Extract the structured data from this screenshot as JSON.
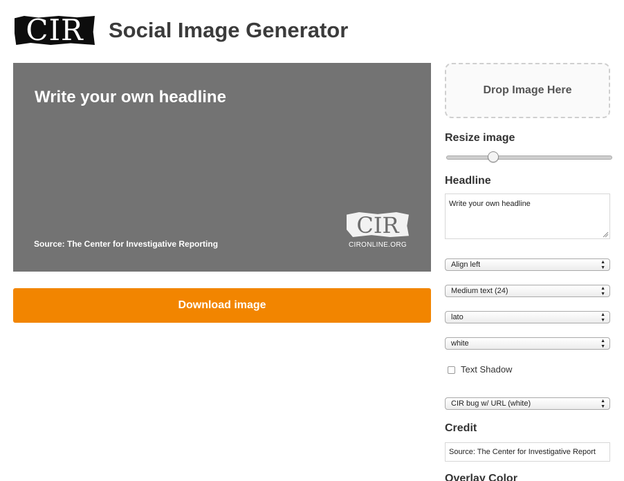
{
  "header": {
    "logo_text": "CIR",
    "title": "Social Image Generator"
  },
  "preview": {
    "headline": "Write your own headline",
    "credit": "Source: The Center for Investigative Reporting",
    "bug_logo": "CIR",
    "bug_url": "CIRONLINE.ORG",
    "background_color": "#737373"
  },
  "download": {
    "label": "Download image",
    "color": "#f28500"
  },
  "controls": {
    "dropzone_label": "Drop Image Here",
    "resize_label": "Resize image",
    "resize_value": 0.27,
    "headline_label": "Headline",
    "headline_value": "Write your own headline",
    "align": "Align left",
    "text_size": "Medium text (24)",
    "font": "lato",
    "text_color": "white",
    "text_shadow_label": "Text Shadow",
    "text_shadow_checked": false,
    "bug": "CIR bug w/ URL (white)",
    "credit_label": "Credit",
    "credit_value": "Source: The Center for Investigative Report",
    "overlay_label": "Overlay Color"
  }
}
